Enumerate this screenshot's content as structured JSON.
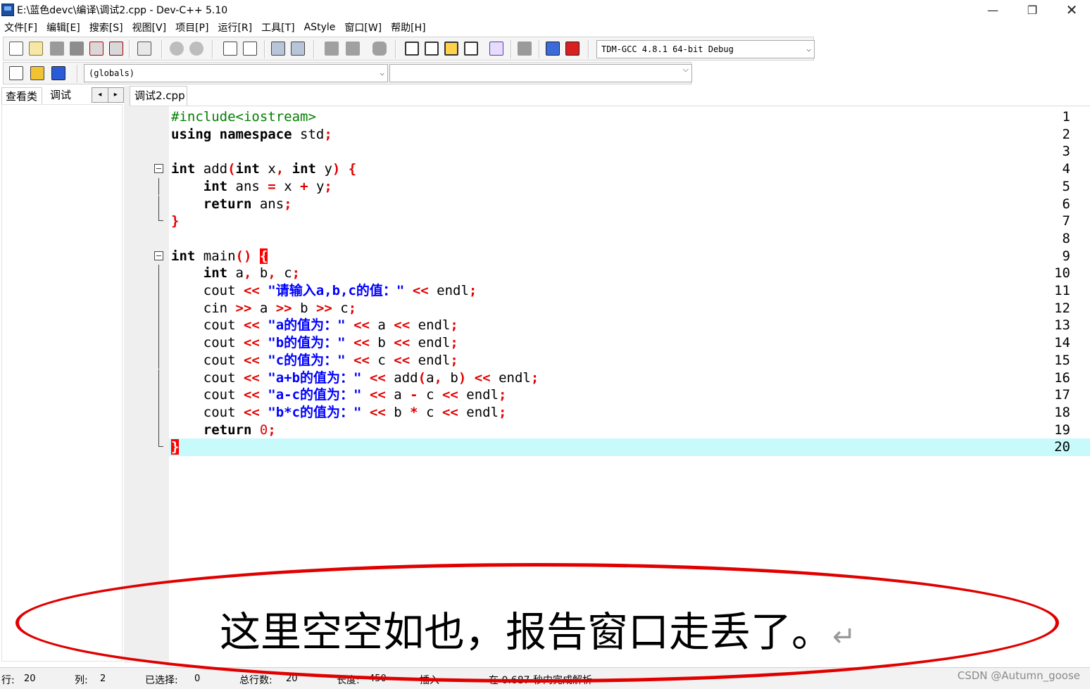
{
  "window": {
    "title": "E:\\蓝色devc\\编译\\调试2.cpp - Dev-C++ 5.10",
    "minimize_glyph": "—",
    "maximize_glyph": "❐",
    "close_glyph": "✕"
  },
  "menu": [
    "文件[F]",
    "编辑[E]",
    "搜索[S]",
    "视图[V]",
    "项目[P]",
    "运行[R]",
    "工具[T]",
    "AStyle",
    "窗口[W]",
    "帮助[H]"
  ],
  "toolbar": {
    "compiler_profile": "TDM-GCC 4.8.1 64-bit Debug",
    "scope": "(globals)",
    "member": "",
    "dropdown_glyph": "⌵"
  },
  "left_panel": {
    "tabs": [
      "查看类",
      "调试"
    ],
    "scroll_left": "◂",
    "scroll_right": "▸"
  },
  "editor": {
    "file_tab": "调试2.cpp",
    "current_line": 20,
    "line_numbers": [
      "1",
      "2",
      "3",
      "4",
      "5",
      "6",
      "7",
      "8",
      "9",
      "10",
      "11",
      "12",
      "13",
      "14",
      "15",
      "16",
      "17",
      "18",
      "19",
      "20"
    ]
  },
  "annotation": {
    "text": "这里空空如也，报告窗口走丢了。",
    "return_mark": "↵"
  },
  "statusbar": {
    "row_label": "行:",
    "row_value": "20",
    "col_label": "列:",
    "col_value": "2",
    "selected_label": "已选择:",
    "selected_value": "0",
    "lines_label": "总行数:",
    "lines_value": "20",
    "length_label": "长度:",
    "length_value": "450",
    "mode": "插入",
    "parse_message": "在 0.687 秒内完成解析"
  },
  "watermark": "CSDN @Autumn_goose",
  "colors": {
    "keyword": "#000000",
    "operator": "#e30000",
    "string": "#0000ff",
    "preprocessor": "#008000",
    "current_line": "#c8fafc",
    "annotation": "#e00000"
  },
  "icons": [
    "new-file-icon",
    "open-file-icon",
    "save-icon",
    "save-all-icon",
    "close-icon",
    "close-all-icon",
    "print-icon",
    "undo-icon",
    "redo-icon",
    "find-icon",
    "replace-icon",
    "indent-icon",
    "unindent-icon",
    "toggle-bookmark-icon",
    "goto-bookmark-icon",
    "comment-icon",
    "compile-icon",
    "run-icon",
    "compile-run-icon",
    "rebuild-icon",
    "syntax-check-icon",
    "stop-icon",
    "profile-icon",
    "debug-icon",
    "new-class-icon",
    "insert-icon",
    "toggle-icon"
  ]
}
